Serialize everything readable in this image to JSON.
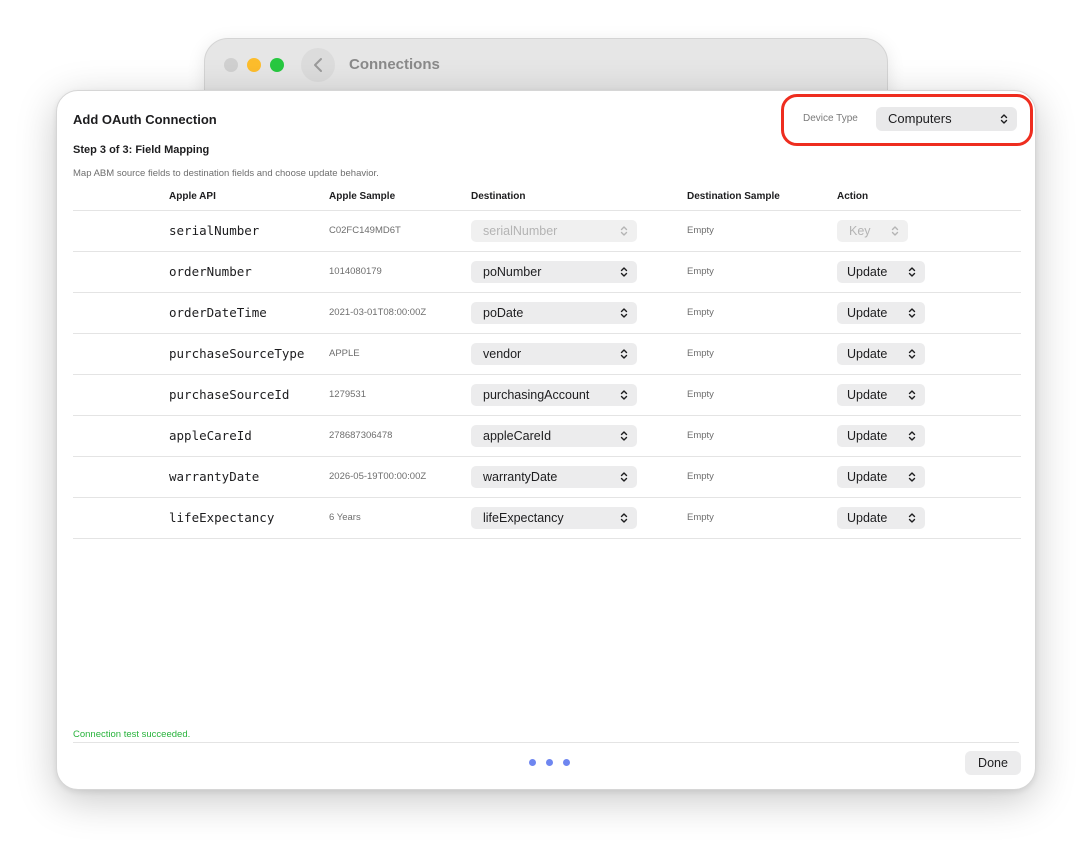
{
  "background_window": {
    "title": "Connections",
    "back_icon": "chevron-left-icon"
  },
  "sheet": {
    "title": "Add OAuth Connection",
    "device_type_label": "Device Type",
    "device_type_value": "Computers",
    "step_title": "Step 3 of 3: Field Mapping",
    "step_description": "Map ABM source fields to destination fields and choose update behavior.",
    "highlight_color": "#ee2d1f"
  },
  "table": {
    "headers": {
      "apple_api": "Apple API",
      "apple_sample": "Apple Sample",
      "destination": "Destination",
      "destination_sample": "Destination Sample",
      "action": "Action"
    },
    "rows": [
      {
        "api": "serialNumber",
        "sample": "C02FC149MD6T",
        "destination": "serialNumber",
        "dest_sample": "Empty",
        "action": "Key"
      },
      {
        "api": "orderNumber",
        "sample": "1014080179",
        "destination": "poNumber",
        "dest_sample": "Empty",
        "action": "Update"
      },
      {
        "api": "orderDateTime",
        "sample": "2021-03-01T08:00:00Z",
        "destination": "poDate",
        "dest_sample": "Empty",
        "action": "Update"
      },
      {
        "api": "purchaseSourceType",
        "sample": "APPLE",
        "destination": "vendor",
        "dest_sample": "Empty",
        "action": "Update"
      },
      {
        "api": "purchaseSourceId",
        "sample": "1279531",
        "destination": "purchasingAccount",
        "dest_sample": "Empty",
        "action": "Update"
      },
      {
        "api": "appleCareId",
        "sample": "278687306478",
        "destination": "appleCareId",
        "dest_sample": "Empty",
        "action": "Update"
      },
      {
        "api": "warrantyDate",
        "sample": "2026-05-19T00:00:00Z",
        "destination": "warrantyDate",
        "dest_sample": "Empty",
        "action": "Update"
      },
      {
        "api": "lifeExpectancy",
        "sample": "6 Years",
        "destination": "lifeExpectancy",
        "dest_sample": "Empty",
        "action": "Update"
      }
    ]
  },
  "footer": {
    "status_text": "Connection test succeeded.",
    "status_color": "#28b33c",
    "page_dots": 3,
    "done_label": "Done"
  },
  "colors": {
    "dot": "#6e86f0",
    "traffic_close": "#d0d0d0",
    "traffic_minimize": "#fdbd2c",
    "traffic_maximize": "#27c840"
  }
}
